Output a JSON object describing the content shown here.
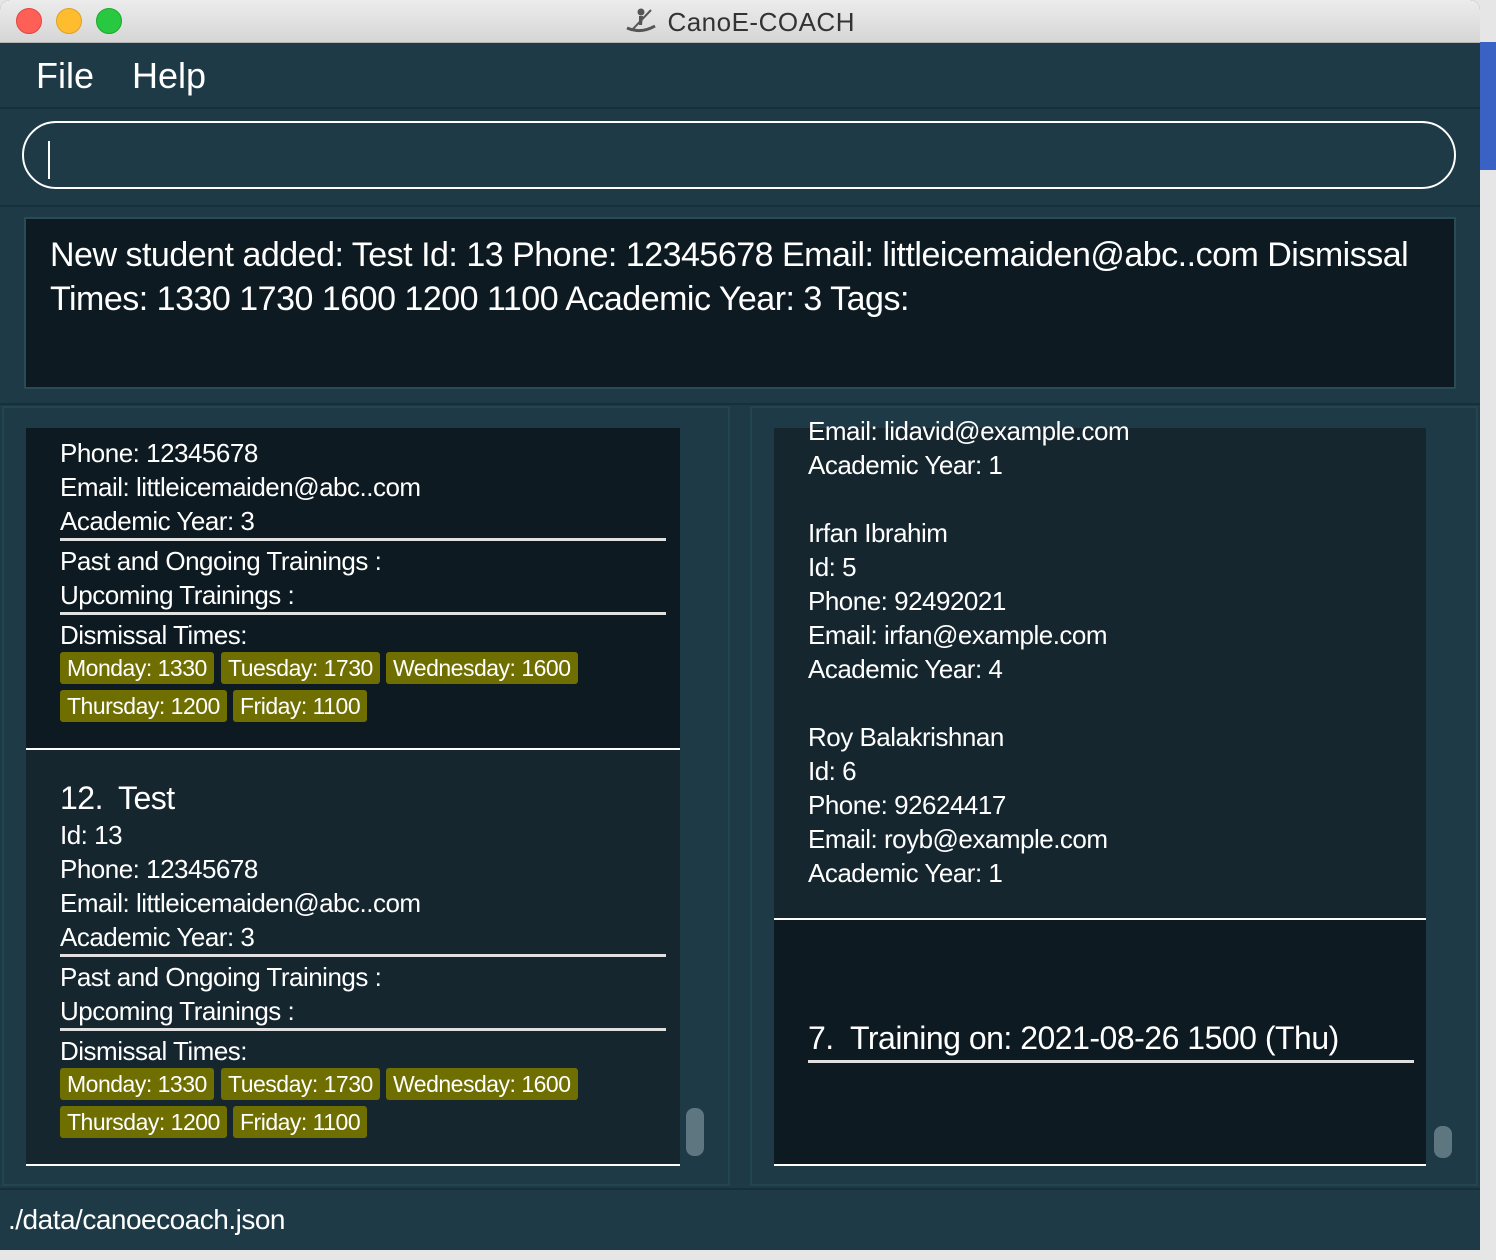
{
  "window": {
    "title": "CanoE-COACH"
  },
  "menu": {
    "file": "File",
    "help": "Help"
  },
  "command": {
    "value": ""
  },
  "result": {
    "text": "New student added: Test Id: 13 Phone: 12345678 Email: littleicemaiden@abc..com Dismissal Times: 1330 1730 1600 1200 1100  Academic  Year: 3 Tags:"
  },
  "students": {
    "partial": {
      "phone": "Phone: 12345678",
      "email": "Email: littleicemaiden@abc..com",
      "year": "Academic Year: 3",
      "past": "Past and Ongoing Trainings :",
      "upcoming": "Upcoming Trainings :",
      "dismissal": "Dismissal Times:",
      "tags": [
        "Monday: 1330",
        "Tuesday: 1730",
        "Wednesday: 1600",
        "Thursday: 1200",
        "Friday: 1100"
      ]
    },
    "card12": {
      "index": "12.",
      "name": "Test",
      "id": "Id: 13",
      "phone": "Phone: 12345678",
      "email": "Email: littleicemaiden@abc..com",
      "year": "Academic Year: 3",
      "past": "Past and Ongoing Trainings :",
      "upcoming": "Upcoming Trainings :",
      "dismissal": "Dismissal Times:",
      "tags": [
        "Monday: 1330",
        "Tuesday: 1730",
        "Wednesday: 1600",
        "Thursday: 1200",
        "Friday: 1100"
      ]
    }
  },
  "trainings": {
    "partial": {
      "lines": [
        "Email: lidavid@example.com",
        "Academic  Year: 1",
        "Irfan Ibrahim",
        "Id: 5",
        "Phone: 92492021",
        "Email: irfan@example.com",
        "Academic  Year: 4",
        "Roy Balakrishnan",
        "Id: 6",
        "Phone: 92624417",
        "Email: royb@example.com",
        "Academic  Year: 1"
      ]
    },
    "card7": {
      "index": "7.",
      "label": "Training on: 2021-08-26 1500 (Thu)"
    }
  },
  "status": {
    "path": "./data/canoecoach.json"
  },
  "colors": {
    "background": "#1d3a46",
    "card": "#0d1a21",
    "tag": "#6f6e00"
  }
}
